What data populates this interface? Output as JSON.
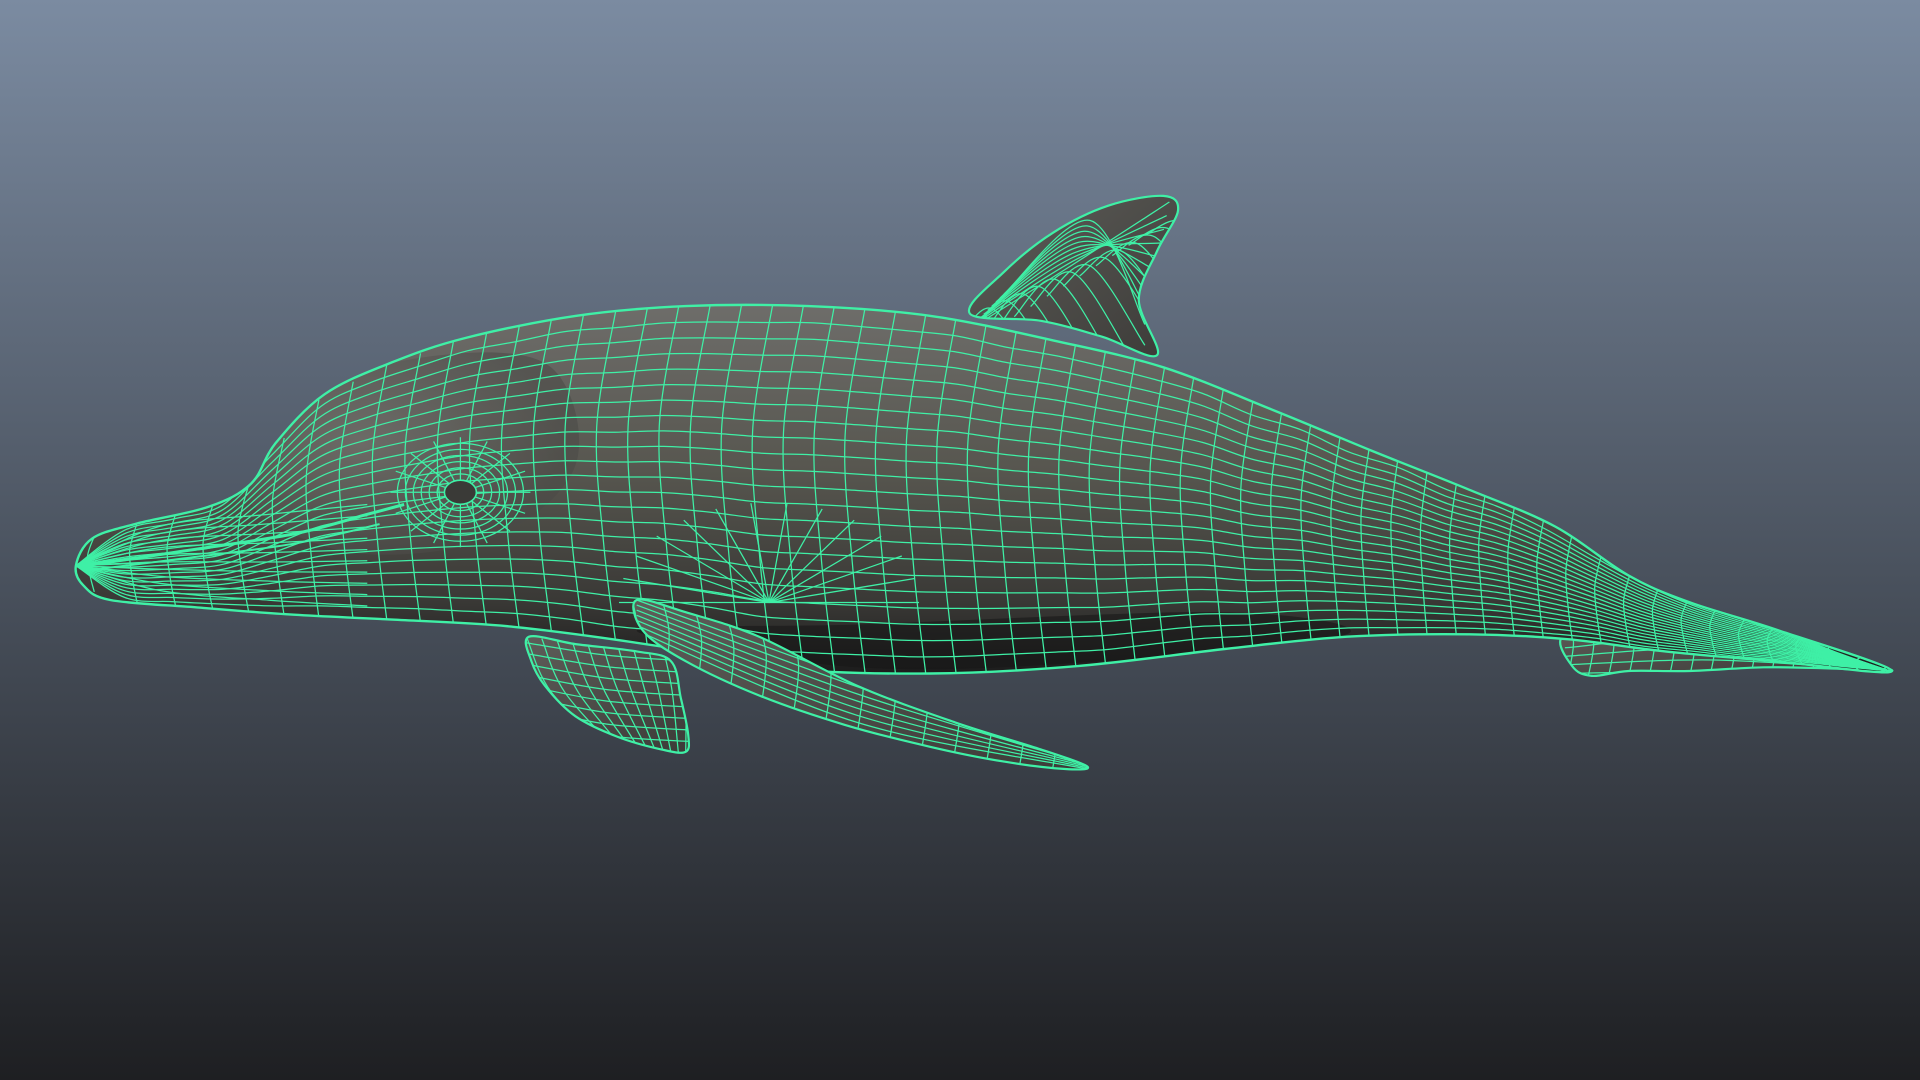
{
  "viewport": {
    "view": "perspective",
    "display_mode": "wireframe-on-shaded",
    "background_gradient": {
      "top": "#7b8ba1",
      "bottom": "#1e1f22"
    },
    "selected_object": "dolphin-mesh",
    "selected": true
  },
  "mesh": {
    "object": "dolphin",
    "wire_color": "#3ff0a6",
    "shade_light": "#6e6d6a",
    "shade_mid": "#4b4a48",
    "shade_dark": "#1c1c1c"
  }
}
